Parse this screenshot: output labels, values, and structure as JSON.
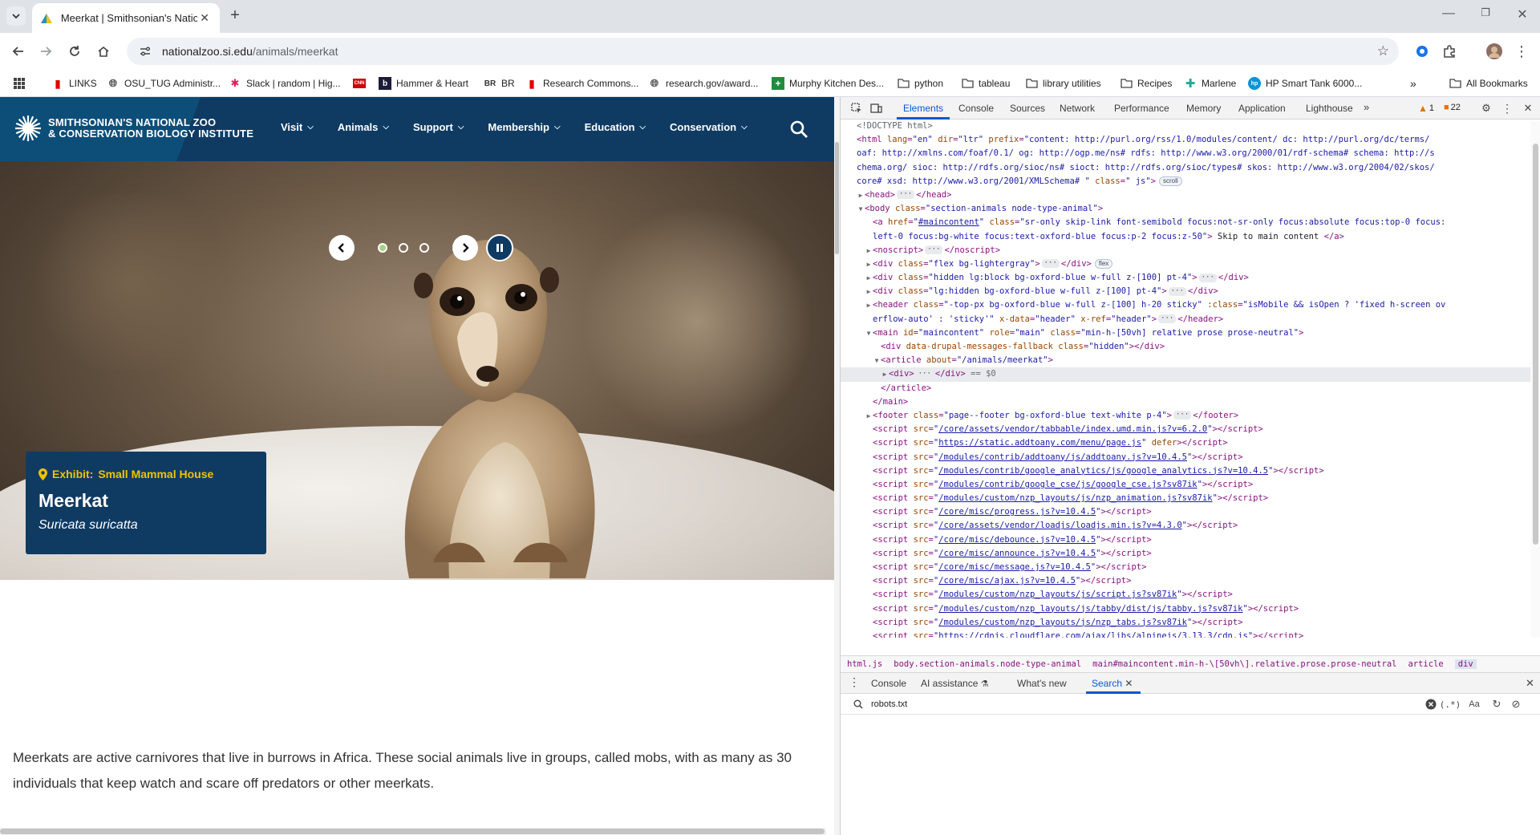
{
  "browser": {
    "tab_title": "Meerkat | Smithsonian's National Zoo",
    "url_host": "nationalzoo.si.edu",
    "url_path": "/animals/meerkat",
    "bookmarks": [
      "LINKS",
      "OSU_TUG Administr...",
      "Slack | random | Hig...",
      "Hammer & Heart",
      "BR",
      "Research Commons...",
      "research.gov/award...",
      "Murphy Kitchen Des...",
      "python",
      "tableau",
      "library utilities",
      "Recipes",
      "Marlene",
      "HP Smart Tank 6000..."
    ],
    "all_bookmarks": "All Bookmarks"
  },
  "site": {
    "logo_line1": "SMITHSONIAN'S NATIONAL ZOO",
    "logo_line2": "& CONSERVATION BIOLOGY INSTITUTE",
    "nav": [
      "Visit",
      "Animals",
      "Support",
      "Membership",
      "Education",
      "Conservation"
    ],
    "exhibit_label": "Exhibit:",
    "exhibit_name": "Small Mammal House",
    "animal_name": "Meerkat",
    "scientific_name": "Suricata suricatta",
    "description": "Meerkats are active carnivores that live in burrows in Africa. These social animals live in groups, called mobs, with as many as 30 individuals that keep watch and scare off predators or other meerkats.",
    "carousel_active_slide": 1,
    "carousel_slide_count": 3
  },
  "devtools": {
    "tabs": [
      "Elements",
      "Console",
      "Sources",
      "Network",
      "Performance",
      "Memory",
      "Application",
      "Lighthouse"
    ],
    "active_tab": "Elements",
    "warnings": "1",
    "issues": "22",
    "code": {
      "doctype": "<!DOCTYPE html>",
      "html_lang": "\"en\"",
      "html_dir": "\"ltr\"",
      "prefix_1": "\"content: http://purl.org/rss/1.0/modules/content/  dc: http://purl.org/dc/terms/",
      "prefix_2": "oaf: http://xmlns.com/foaf/0.1/  og: http://ogp.me/ns#  rdfs: http://www.w3.org/2000/01/rdf-schema#  schema: http://s",
      "prefix_3": "chema.org/  sioc: http://rdfs.org/sioc/ns#  sioct: http://rdfs.org/sioc/types#  skos: http://www.w3.org/2004/02/skos/",
      "prefix_4": "core#  xsd: http://www.w3.org/2001/XMLSchema# \"",
      "html_class": "\" js\"",
      "scroll_badge": "scroll",
      "body_class": "\"section-animals node-type-animal\"",
      "skip_href": "#maincontent",
      "skip_class_1": "\"sr-only skip-link font-semibold focus:not-sr-only focus:absolute focus:top-0 focus:",
      "skip_class_2": "left-0 focus:bg-white focus:text-oxford-blue focus:p-2 focus:z-50\"",
      "skip_text": " Skip to main content ",
      "div1_class": "\"flex bg-lightergray\"",
      "flex_badge": "flex",
      "div2_class": "\"hidden lg:block bg-oxford-blue w-full z-[100] pt-4\"",
      "div3_class": "\"lg:hidden bg-oxford-blue w-full z-[100] pt-4\"",
      "header_class": "\"-top-px bg-oxford-blue w-full z-[100] h-20 sticky\"",
      "header_bind_1": "\"isMobile && isOpen ? 'fixed h-screen ov",
      "header_bind_2": "erflow-auto' : 'sticky'\"",
      "header_xdata": "\"header\"",
      "header_xref": "\"header\"",
      "main_id": "\"maincontent\"",
      "main_role": "\"main\"",
      "main_class": "\"min-h-[50vh] relative prose prose-neutral\"",
      "messages_class": "\"hidden\"",
      "article_about": "\"/animals/meerkat\"",
      "sel_marker": "== $0",
      "footer_class": "\"page--footer bg-oxford-blue text-white p-4\"",
      "scripts": [
        "/core/assets/vendor/tabbable/index.umd.min.js?v=6.2.0",
        "https://static.addtoany.com/menu/page.js",
        "/modules/contrib/addtoany/js/addtoany.js?v=10.4.5",
        "/modules/contrib/google_analytics/js/google_analytics.js?v=10.4.5",
        "/modules/contrib/google_cse/js/google_cse.js?sv87ik",
        "/modules/custom/nzp_layouts/js/nzp_animation.js?sv87ik",
        "/core/misc/progress.js?v=10.4.5",
        "/core/assets/vendor/loadjs/loadjs.min.js?v=4.3.0",
        "/core/misc/debounce.js?v=10.4.5",
        "/core/misc/announce.js?v=10.4.5",
        "/core/misc/message.js?v=10.4.5",
        "/core/misc/ajax.js?v=10.4.5",
        "/modules/custom/nzp_layouts/js/script.js?sv87ik",
        "/modules/custom/nzp_layouts/js/tabby/dist/js/tabby.js?sv87ik",
        "/modules/custom/nzp_layouts/js/nzp_tabs.js?sv87ik",
        "https://cdnjs.cloudflare.com/ajax/libs/alpinejs/3.13.3/cdn.js"
      ],
      "addtoany_id": "\"addtoany\"",
      "addtoany_style": "\"position: static;\""
    },
    "breadcrumbs": [
      "html.js",
      "body.section-animals.node-type-animal",
      "main#maincontent.min-h-\\[50vh\\].relative.prose.prose-neutral",
      "article",
      "div"
    ],
    "drawer_tabs": [
      "Console",
      "AI assistance",
      "What's new",
      "Search"
    ],
    "search_query": "robots.txt"
  },
  "colors": {
    "brand_blue": "#0f3b63",
    "exhibit_yellow": "#f2c200",
    "devtools_accent": "#0b57d0"
  }
}
